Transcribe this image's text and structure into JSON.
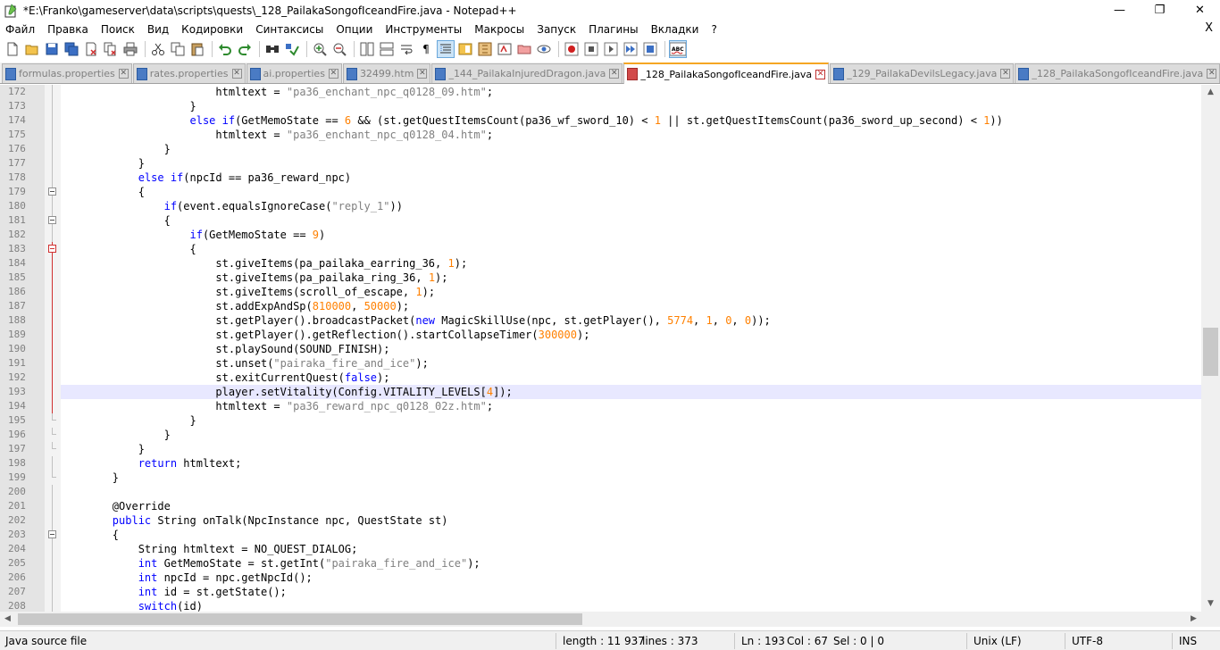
{
  "window": {
    "title": "*E:\\Franko\\gameserver\\data\\scripts\\quests\\_128_PailakaSongofIceandFire.java - Notepad++",
    "minimize": "—",
    "maximize": "❐",
    "close": "✕"
  },
  "menu": {
    "items": [
      "Файл",
      "Правка",
      "Поиск",
      "Вид",
      "Кодировки",
      "Синтаксисы",
      "Опции",
      "Инструменты",
      "Макросы",
      "Запуск",
      "Плагины",
      "Вкладки",
      "?"
    ],
    "close_doc": "X"
  },
  "toolbar": {
    "icons": [
      "new-file-icon",
      "open-file-icon",
      "save-icon",
      "save-all-icon",
      "close-icon",
      "close-all-icon",
      "print-icon",
      "cut-icon",
      "copy-icon",
      "paste-icon",
      "undo-icon",
      "redo-icon",
      "find-icon",
      "replace-icon",
      "zoom-in-icon",
      "zoom-out-icon",
      "sync-v-icon",
      "sync-h-icon",
      "word-wrap-icon",
      "show-all-chars-icon",
      "indent-guide-icon",
      "doc-map-icon",
      "function-list-icon",
      "folder-workspace-icon",
      "monitor-icon",
      "record-macro-icon",
      "stop-macro-icon",
      "play-macro-icon",
      "run-macro-icon",
      "save-macro-icon",
      "spellcheck-icon"
    ],
    "spellcheck_label": "ABC",
    "pilcrow": "¶"
  },
  "tabs": [
    {
      "label": "formulas.properties",
      "active": false
    },
    {
      "label": "rates.properties",
      "active": false
    },
    {
      "label": "ai.properties",
      "active": false
    },
    {
      "label": "32499.htm",
      "active": false
    },
    {
      "label": "_144_PailakaInjuredDragon.java",
      "active": false
    },
    {
      "label": "_128_PailakaSongofIceandFire.java",
      "active": true
    },
    {
      "label": "_129_PailakaDevilsLegacy.java",
      "active": false
    },
    {
      "label": "_128_PailakaSongofIceandFire.java",
      "active": false
    }
  ],
  "editor": {
    "current_line": 193,
    "lines": [
      {
        "n": "172",
        "fold": "line",
        "t": [
          [
            "",
            "                        htmltext = "
          ],
          [
            "str",
            "\"pa36_enchant_npc_q0128_09.htm\""
          ],
          [
            "",
            ";"
          ]
        ]
      },
      {
        "n": "173",
        "fold": "line",
        "t": [
          [
            "",
            "                    }"
          ]
        ]
      },
      {
        "n": "174",
        "fold": "line",
        "t": [
          [
            "",
            "                    "
          ],
          [
            "kw",
            "else if"
          ],
          [
            "",
            "(GetMemoState == "
          ],
          [
            "num",
            "6"
          ],
          [
            "",
            " && (st.getQuestItemsCount(pa36_wf_sword_10) < "
          ],
          [
            "num",
            "1"
          ],
          [
            "",
            " || st.getQuestItemsCount(pa36_sword_up_second) < "
          ],
          [
            "num",
            "1"
          ],
          [
            "",
            "))"
          ]
        ]
      },
      {
        "n": "175",
        "fold": "line",
        "t": [
          [
            "",
            "                        htmltext = "
          ],
          [
            "str",
            "\"pa36_enchant_npc_q0128_04.htm\""
          ],
          [
            "",
            ";"
          ]
        ]
      },
      {
        "n": "176",
        "fold": "line",
        "t": [
          [
            "",
            "                }"
          ]
        ]
      },
      {
        "n": "177",
        "fold": "line",
        "t": [
          [
            "",
            "            }"
          ]
        ]
      },
      {
        "n": "178",
        "fold": "line",
        "t": [
          [
            "",
            "            "
          ],
          [
            "kw",
            "else if"
          ],
          [
            "",
            "(npcId == pa36_reward_npc)"
          ]
        ]
      },
      {
        "n": "179",
        "fold": "box",
        "t": [
          [
            "",
            "            {"
          ]
        ]
      },
      {
        "n": "180",
        "fold": "line",
        "t": [
          [
            "",
            "                "
          ],
          [
            "kw",
            "if"
          ],
          [
            "",
            "(event.equalsIgnoreCase("
          ],
          [
            "str",
            "\"reply_1\""
          ],
          [
            "",
            "))"
          ]
        ]
      },
      {
        "n": "181",
        "fold": "box",
        "t": [
          [
            "",
            "                {"
          ]
        ]
      },
      {
        "n": "182",
        "fold": "line",
        "t": [
          [
            "",
            "                    "
          ],
          [
            "kw",
            "if"
          ],
          [
            "",
            "(GetMemoState == "
          ],
          [
            "num",
            "9"
          ],
          [
            "",
            ")"
          ]
        ]
      },
      {
        "n": "183",
        "fold": "boxred",
        "t": [
          [
            "",
            "                    {"
          ]
        ]
      },
      {
        "n": "184",
        "fold": "red",
        "t": [
          [
            "",
            "                        st.giveItems(pa_pailaka_earring_36, "
          ],
          [
            "num",
            "1"
          ],
          [
            "",
            ");"
          ]
        ]
      },
      {
        "n": "185",
        "fold": "red",
        "t": [
          [
            "",
            "                        st.giveItems(pa_pailaka_ring_36, "
          ],
          [
            "num",
            "1"
          ],
          [
            "",
            ");"
          ]
        ]
      },
      {
        "n": "186",
        "fold": "red",
        "t": [
          [
            "",
            "                        st.giveItems(scroll_of_escape, "
          ],
          [
            "num",
            "1"
          ],
          [
            "",
            ");"
          ]
        ]
      },
      {
        "n": "187",
        "fold": "red",
        "t": [
          [
            "",
            "                        st.addExpAndSp("
          ],
          [
            "num",
            "810000"
          ],
          [
            "",
            ", "
          ],
          [
            "num",
            "50000"
          ],
          [
            "",
            ");"
          ]
        ]
      },
      {
        "n": "188",
        "fold": "red",
        "t": [
          [
            "",
            "                        st.getPlayer().broadcastPacket("
          ],
          [
            "kw",
            "new"
          ],
          [
            "",
            " MagicSkillUse(npc, st.getPlayer(), "
          ],
          [
            "num",
            "5774"
          ],
          [
            "",
            ", "
          ],
          [
            "num",
            "1"
          ],
          [
            "",
            ", "
          ],
          [
            "num",
            "0"
          ],
          [
            "",
            ", "
          ],
          [
            "num",
            "0"
          ],
          [
            "",
            "));"
          ]
        ]
      },
      {
        "n": "189",
        "fold": "red",
        "t": [
          [
            "",
            "                        st.getPlayer().getReflection().startCollapseTimer("
          ],
          [
            "num",
            "300000"
          ],
          [
            "",
            ");"
          ]
        ]
      },
      {
        "n": "190",
        "fold": "red",
        "t": [
          [
            "",
            "                        st.playSound(SOUND_FINISH);"
          ]
        ]
      },
      {
        "n": "191",
        "fold": "red",
        "t": [
          [
            "",
            "                        st.unset("
          ],
          [
            "str",
            "\"pairaka_fire_and_ice\""
          ],
          [
            "",
            ");"
          ]
        ]
      },
      {
        "n": "192",
        "fold": "red",
        "t": [
          [
            "",
            "                        st.exitCurrentQuest("
          ],
          [
            "kw",
            "false"
          ],
          [
            "",
            ");"
          ]
        ]
      },
      {
        "n": "193",
        "fold": "red",
        "t": [
          [
            "",
            "                        player.setVitality(Config.VITALITY_LEVELS["
          ],
          [
            "num",
            "4"
          ],
          [
            "",
            "]);"
          ]
        ]
      },
      {
        "n": "194",
        "fold": "red",
        "t": [
          [
            "",
            "                        htmltext = "
          ],
          [
            "str",
            "\"pa36_reward_npc_q0128_02z.htm\""
          ],
          [
            "",
            ";"
          ]
        ]
      },
      {
        "n": "195",
        "fold": "end",
        "t": [
          [
            "",
            "                    }"
          ]
        ]
      },
      {
        "n": "196",
        "fold": "end",
        "t": [
          [
            "",
            "                }"
          ]
        ]
      },
      {
        "n": "197",
        "fold": "end",
        "t": [
          [
            "",
            "            }"
          ]
        ]
      },
      {
        "n": "198",
        "fold": "line",
        "t": [
          [
            "",
            "            "
          ],
          [
            "kw",
            "return"
          ],
          [
            "",
            " htmltext;"
          ]
        ]
      },
      {
        "n": "199",
        "fold": "end",
        "t": [
          [
            "",
            "        }"
          ]
        ]
      },
      {
        "n": "200",
        "fold": "line",
        "t": [
          [
            "",
            ""
          ]
        ]
      },
      {
        "n": "201",
        "fold": "line",
        "t": [
          [
            "",
            "        @Override"
          ]
        ]
      },
      {
        "n": "202",
        "fold": "line",
        "t": [
          [
            "",
            "        "
          ],
          [
            "kw",
            "public"
          ],
          [
            "",
            " String onTalk(NpcInstance npc, QuestState st)"
          ]
        ]
      },
      {
        "n": "203",
        "fold": "box",
        "t": [
          [
            "",
            "        {"
          ]
        ]
      },
      {
        "n": "204",
        "fold": "line",
        "t": [
          [
            "",
            "            String htmltext = NO_QUEST_DIALOG;"
          ]
        ]
      },
      {
        "n": "205",
        "fold": "line",
        "t": [
          [
            "",
            "            "
          ],
          [
            "kw",
            "int"
          ],
          [
            "",
            " GetMemoState = st.getInt("
          ],
          [
            "str",
            "\"pairaka_fire_and_ice\""
          ],
          [
            "",
            ");"
          ]
        ]
      },
      {
        "n": "206",
        "fold": "line",
        "t": [
          [
            "",
            "            "
          ],
          [
            "kw",
            "int"
          ],
          [
            "",
            " npcId = npc.getNpcId();"
          ]
        ]
      },
      {
        "n": "207",
        "fold": "line",
        "t": [
          [
            "",
            "            "
          ],
          [
            "kw",
            "int"
          ],
          [
            "",
            " id = st.getState();"
          ]
        ]
      },
      {
        "n": "208",
        "fold": "line",
        "t": [
          [
            "",
            "            "
          ],
          [
            "kw",
            "switch"
          ],
          [
            "",
            "(id)"
          ]
        ]
      }
    ]
  },
  "scroll": {
    "up": "▲",
    "down": "▼",
    "left": "◀",
    "right": "▶"
  },
  "status": {
    "file_type": "Java source file",
    "length": "length : 11 937",
    "lines": "lines : 373",
    "ln": "Ln : 193",
    "col": "Col : 67",
    "sel": "Sel : 0 | 0",
    "eol": "Unix (LF)",
    "encoding": "UTF-8",
    "mode": "INS"
  }
}
